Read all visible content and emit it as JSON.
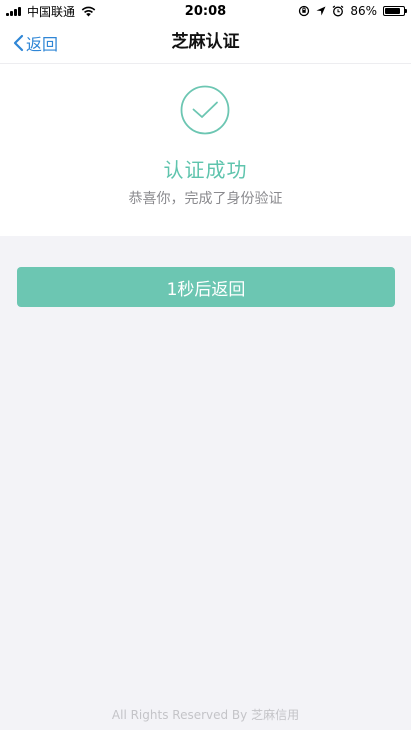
{
  "status_bar": {
    "carrier": "中国联通",
    "time": "20:08",
    "battery_percent": "86%",
    "battery_level": 0.86,
    "icons": [
      "signal-bars-icon",
      "wifi-icon",
      "orientation-lock-icon",
      "location-arrow-icon",
      "alarm-icon",
      "battery-icon"
    ]
  },
  "nav": {
    "back_label": "返回",
    "title": "芝麻认证"
  },
  "success": {
    "title": "认证成功",
    "subtitle": "恭喜你，完成了身份验证"
  },
  "return_button": {
    "label": "1秒后返回"
  },
  "footer": {
    "text": "All Rights Reserved By 芝麻信用"
  },
  "colors": {
    "accent": "#6cc6b2",
    "success_text": "#5fc4ad",
    "link_blue": "#2f86d6",
    "page_bg": "#f3f3f7"
  }
}
